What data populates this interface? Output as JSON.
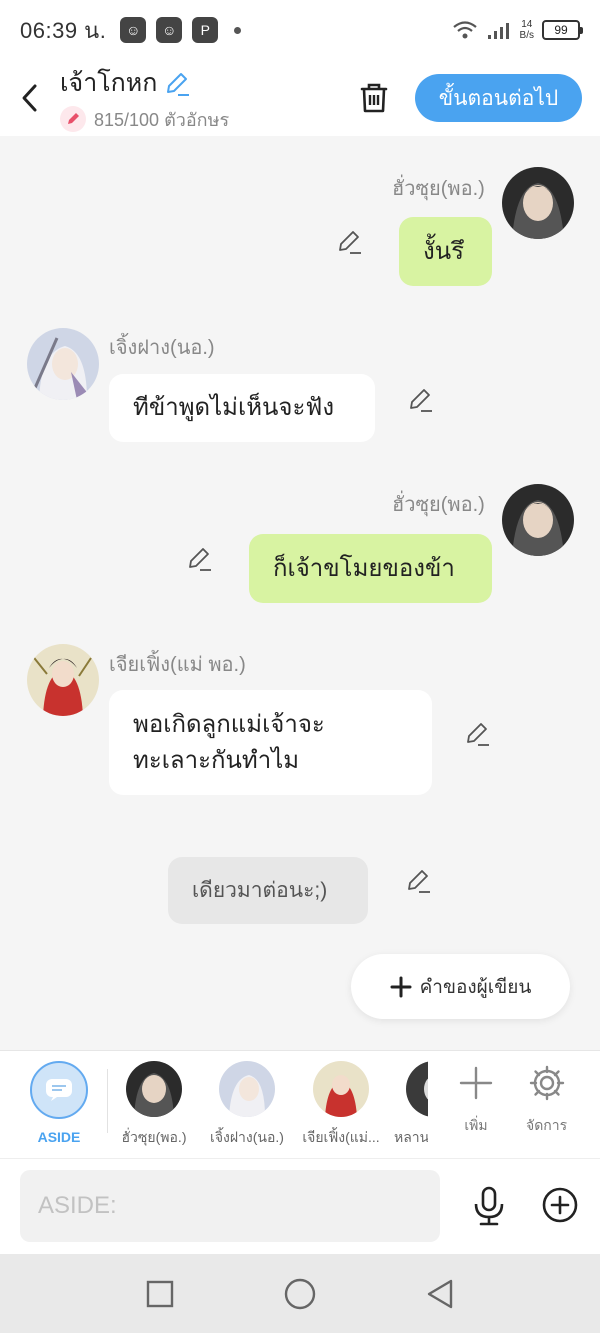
{
  "status_bar": {
    "time": "06:39 น.",
    "net_speed_top": "14",
    "net_speed_bottom": "B/s",
    "battery": "99"
  },
  "header": {
    "title": "เจ้าโกหก",
    "char_count": "815/100 ตัวอักษร",
    "next_label": "ขั้นตอนต่อไป"
  },
  "messages": [
    {
      "speaker": "ฮั่วซุย(พอ.)",
      "text": "งั้นรึ",
      "side": "right"
    },
    {
      "speaker": "เจิ้งฝาง(นอ.)",
      "text": "ทีข้าพูดไม่เห็นจะฟัง",
      "side": "left"
    },
    {
      "speaker": "ฮั่วซุย(พอ.)",
      "text": "ก็เจ้าขโมยของข้า",
      "side": "right"
    },
    {
      "speaker": "เจียเฟิ้ง(แม่ พอ.)",
      "text_line1": "พอเกิดลูกแม่เจ้าจะ",
      "text_line2": "ทะเลาะกันทำไม",
      "side": "left"
    },
    {
      "speaker": "",
      "text": "เดียวมาต่อนะ;)",
      "side": "aside"
    }
  ],
  "author_note_label": "คำของผู้เขียน",
  "character_bar": {
    "aside_label": "ASIDE",
    "characters": [
      "ฮั่วซุย(พอ.)",
      "เจิ้งฝาง(นอ.)",
      "เจียเฟิ้ง(แม่...",
      "หลาน"
    ],
    "add_label": "เพิ่ม",
    "manage_label": "จัดการ"
  },
  "input": {
    "placeholder": "ASIDE:"
  },
  "colors": {
    "accent": "#4aa3f0",
    "right_bubble": "#d8f3a2",
    "left_bubble": "#ffffff",
    "aside_bubble": "#e7e7e7"
  }
}
